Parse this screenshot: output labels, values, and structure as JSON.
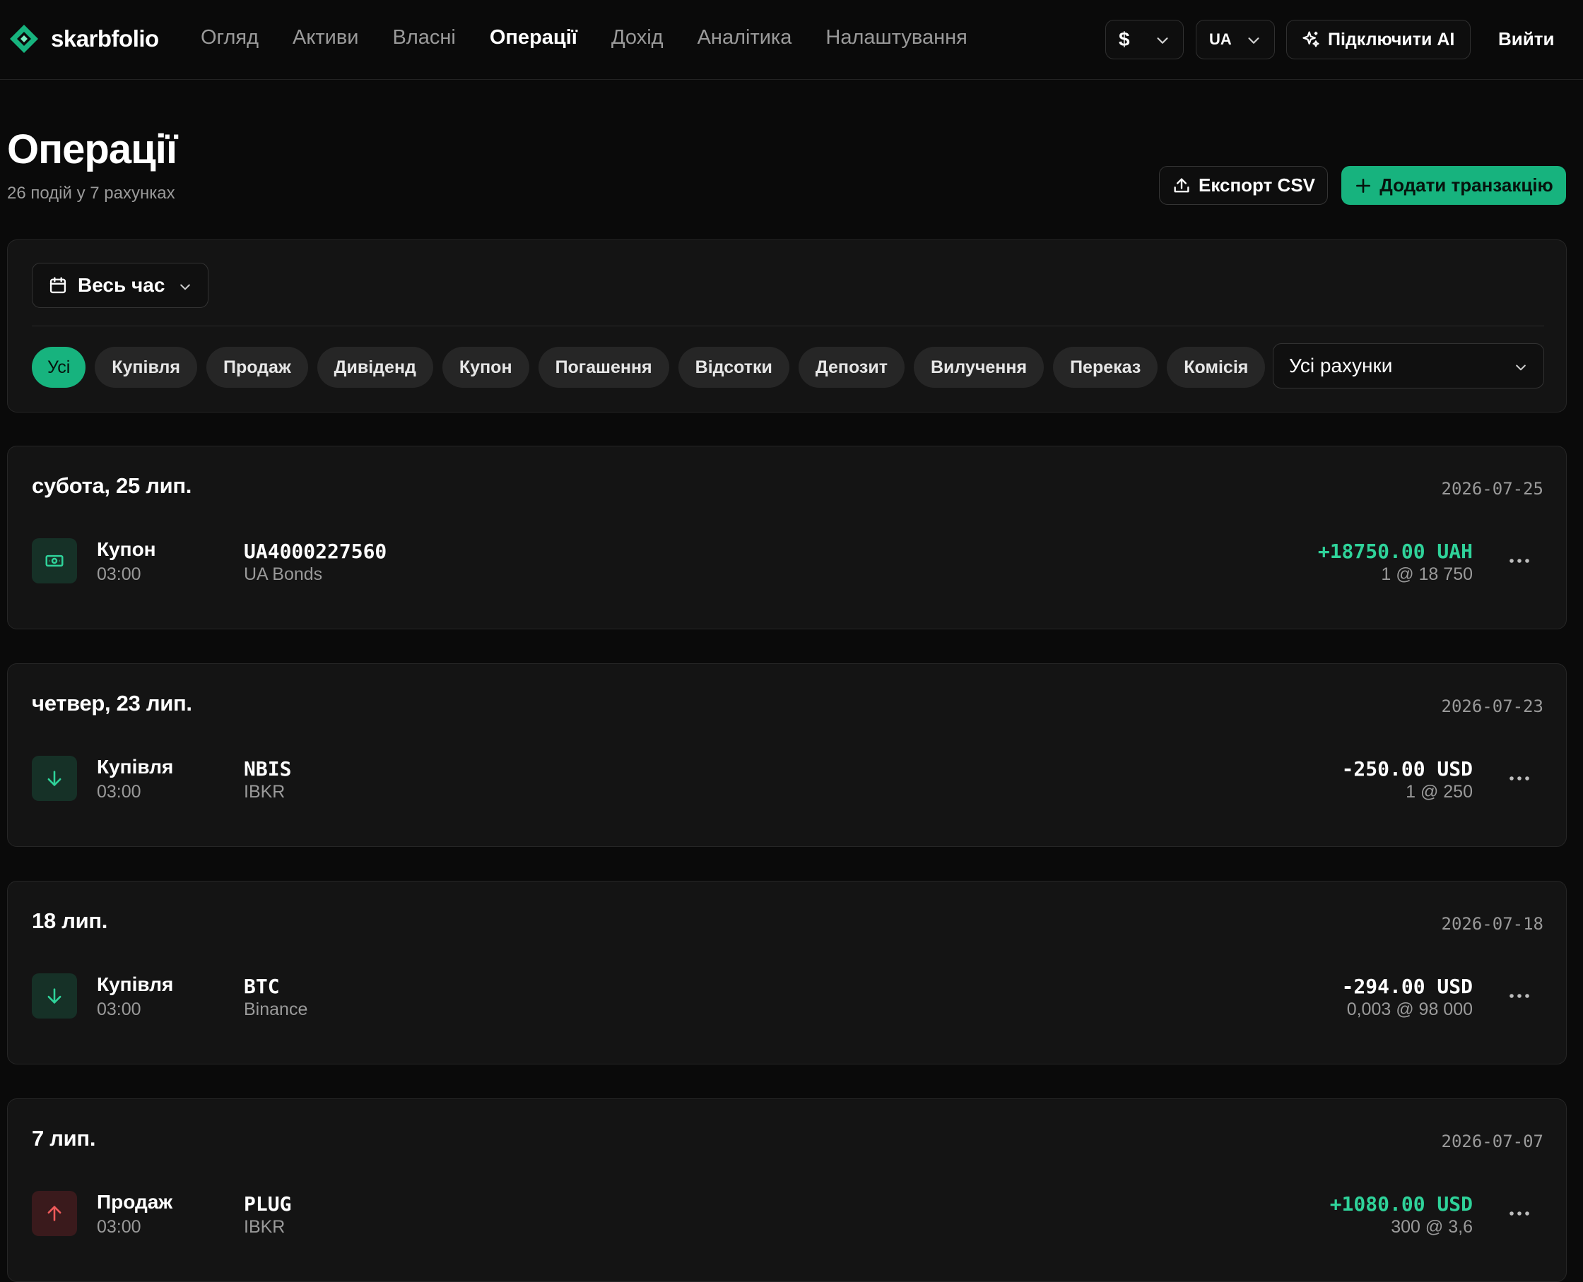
{
  "app": {
    "name": "skarbfolio"
  },
  "nav": {
    "items": [
      {
        "label": "Огляд"
      },
      {
        "label": "Активи"
      },
      {
        "label": "Власні"
      },
      {
        "label": "Операції",
        "active": true
      },
      {
        "label": "Дохід"
      },
      {
        "label": "Аналітика"
      },
      {
        "label": "Налаштування"
      }
    ],
    "currency": "$",
    "language": "UA",
    "ai_button": "Підключити AI",
    "logout": "Вийти"
  },
  "header": {
    "title": "Операції",
    "subtitle": "26 подій у 7 рахунках",
    "export_label": "Експорт CSV",
    "add_label": "Додати транзакцію"
  },
  "filters": {
    "period": "Весь час",
    "chips": [
      "Усі",
      "Купівля",
      "Продаж",
      "Дивіденд",
      "Купон",
      "Погашення",
      "Відсотки",
      "Депозит",
      "Вилучення",
      "Переказ",
      "Комісія"
    ],
    "active_chip": "Усі",
    "account": "Усі рахунки"
  },
  "colors": {
    "accent": "#17b37e",
    "positive": "#2fd39a",
    "negative_icon": "#ef5a5a"
  },
  "days": [
    {
      "label": "субота, 25 лип.",
      "date": "2026-07-25",
      "txn": {
        "icon": "coupon-icon",
        "type": "Купон",
        "time": "03:00",
        "ticker": "UA4000227560",
        "account": "UA Bonds",
        "amount": "+18750.00 UAH",
        "qty": "1 @ 18 750",
        "positive": true
      }
    },
    {
      "label": "четвер, 23 лип.",
      "date": "2026-07-23",
      "txn": {
        "icon": "arrow-down-icon",
        "type": "Купівля",
        "time": "03:00",
        "ticker": "NBIS",
        "account": "IBKR",
        "amount": "-250.00 USD",
        "qty": "1 @ 250",
        "positive": false
      }
    },
    {
      "label": "18 лип.",
      "date": "2026-07-18",
      "txn": {
        "icon": "arrow-down-icon",
        "type": "Купівля",
        "time": "03:00",
        "ticker": "BTC",
        "account": "Binance",
        "amount": "-294.00 USD",
        "qty": "0,003 @ 98 000",
        "positive": false
      }
    },
    {
      "label": "7 лип.",
      "date": "2026-07-07",
      "txn": {
        "icon": "arrow-up-icon",
        "type": "Продаж",
        "time": "03:00",
        "ticker": "PLUG",
        "account": "IBKR",
        "amount": "+1080.00 USD",
        "qty": "300 @ 3,6",
        "positive": true
      }
    }
  ]
}
